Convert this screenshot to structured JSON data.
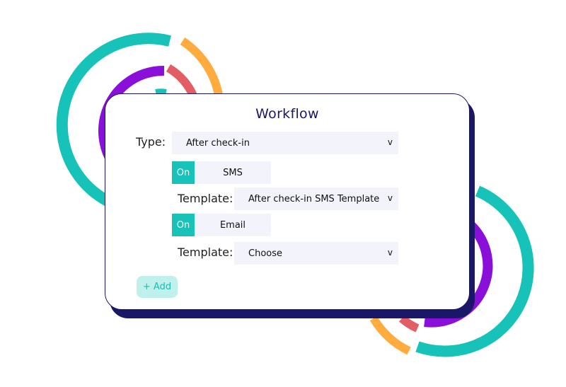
{
  "colors": {
    "navy": "#1a1668",
    "teal": "#17c3b8",
    "purple": "#8a0fd8",
    "orange": "#ffab3d",
    "coral": "#e35e64",
    "field_bg": "#f3f4fb"
  },
  "workflow": {
    "title": "Workflow",
    "type_label": "Type:",
    "type_value": "After check-in",
    "channels": [
      {
        "toggle": "On",
        "name": "SMS",
        "template_label": "Template:",
        "template_value": "After check-in SMS Template"
      },
      {
        "toggle": "On",
        "name": "Email",
        "template_label": "Template:",
        "template_value": "Choose"
      }
    ],
    "chevron": "v",
    "add_label": "+ Add"
  }
}
